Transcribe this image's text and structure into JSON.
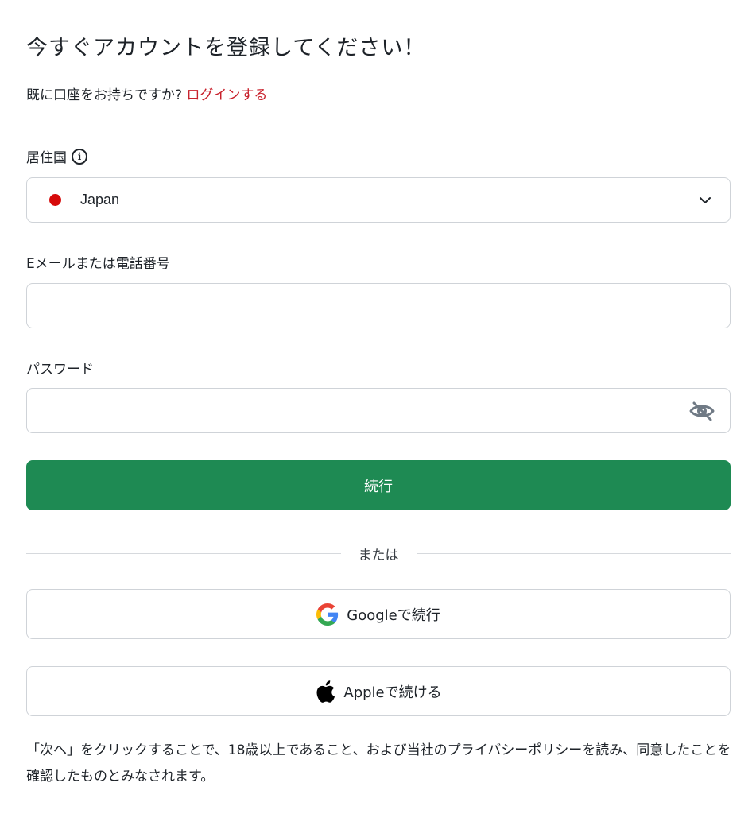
{
  "header": {
    "title": "今すぐアカウントを登録してください！",
    "login_prompt": "既に口座をお持ちですか?",
    "login_link": "ログインする"
  },
  "form": {
    "country": {
      "label": "居住国",
      "info_icon": "info-icon",
      "value": "Japan",
      "flag_color": "#d60a0a"
    },
    "email": {
      "label": "Eメールまたは電話番号",
      "value": "",
      "placeholder": ""
    },
    "password": {
      "label": "パスワード",
      "value": "",
      "placeholder": "",
      "toggle_icon": "eye-off-icon"
    },
    "continue_label": "続行"
  },
  "divider": {
    "text": "または"
  },
  "social": {
    "google_label": "Googleで続行",
    "apple_label": "Appleで続ける"
  },
  "disclaimer": "「次へ」をクリックすることで、18歳以上であること、および当社のプライバシーポリシーを読み、同意したことを確認したものとみなされます。",
  "colors": {
    "accent_green": "#1e8a53",
    "link_red": "#c8202b"
  }
}
